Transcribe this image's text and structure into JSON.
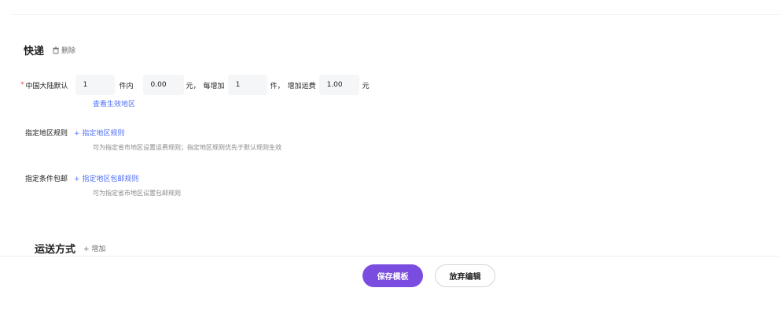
{
  "section": {
    "title": "快递",
    "delete_label": "删除"
  },
  "default_rule": {
    "required_mark": "*",
    "label": "中国大陆默认",
    "first_qty": "1",
    "first_unit": "件内",
    "first_fee": "0.00",
    "yuan_sep": "元，",
    "each_add_label": "每增加",
    "add_qty": "1",
    "add_unit": "件，",
    "add_fee_label": "增加运费",
    "add_fee": "1.00",
    "yuan": "元",
    "view_regions_link": "查看生效地区"
  },
  "region_rule": {
    "label": "指定地区规则",
    "add_link": "+ 指定地区规则",
    "hint": "可为指定省市地区设置运费规则；指定地区规则优先于默认规则生效"
  },
  "free_shipping": {
    "label": "指定条件包邮",
    "add_link": "+ 指定地区包邮规则",
    "hint": "可为指定省市地区设置包邮规则"
  },
  "shipping_method": {
    "title": "运送方式",
    "add_label": "+ 增加"
  },
  "footer": {
    "save_label": "保存模板",
    "discard_label": "放弃编辑"
  },
  "colors": {
    "primary": "#7b4ce0",
    "link": "#4f6ef7",
    "required": "#e34d59"
  }
}
